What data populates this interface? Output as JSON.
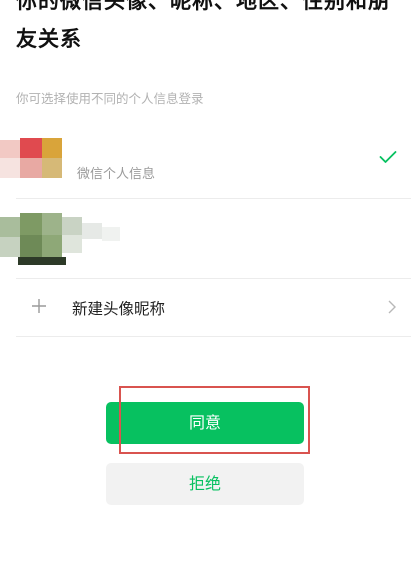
{
  "header": {
    "title": "你的微信头像、昵称、地区、性别和朋友关系",
    "subtitle": "你可选择使用不同的个人信息登录"
  },
  "options": [
    {
      "label": "微信个人信息",
      "selected": true
    },
    {
      "label": "",
      "selected": false
    }
  ],
  "add_profile": {
    "label": "新建头像昵称"
  },
  "actions": {
    "agree_label": "同意",
    "reject_label": "拒绝"
  },
  "colors": {
    "accent": "#07c160",
    "highlight": "#d9534f",
    "check": "#07c160"
  },
  "icons": [
    "check-icon",
    "plus-icon",
    "chevron-right-icon"
  ]
}
